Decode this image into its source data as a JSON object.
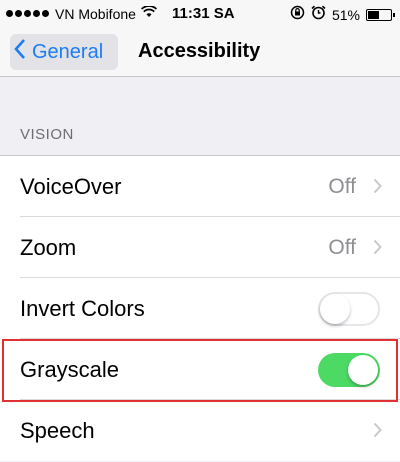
{
  "status_bar": {
    "carrier": "VN Mobifone",
    "time": "11:31 SA",
    "battery_percent": "51%",
    "battery_level": 0.51
  },
  "nav": {
    "back_label": "General",
    "title": "Accessibility"
  },
  "section": {
    "header": "VISION"
  },
  "rows": [
    {
      "label": "VoiceOver",
      "value": "Off"
    },
    {
      "label": "Zoom",
      "value": "Off"
    },
    {
      "label": "Invert Colors",
      "toggle": "off"
    },
    {
      "label": "Grayscale",
      "toggle": "on"
    },
    {
      "label": "Speech"
    }
  ],
  "colors": {
    "accent": "#1c7cf4",
    "toggle_on": "#4cd964",
    "highlight": "#e03030"
  },
  "icons": [
    "wifi-icon",
    "orientation-lock-icon",
    "alarm-icon",
    "battery-icon",
    "chevron-left-icon",
    "chevron-right-icon"
  ]
}
